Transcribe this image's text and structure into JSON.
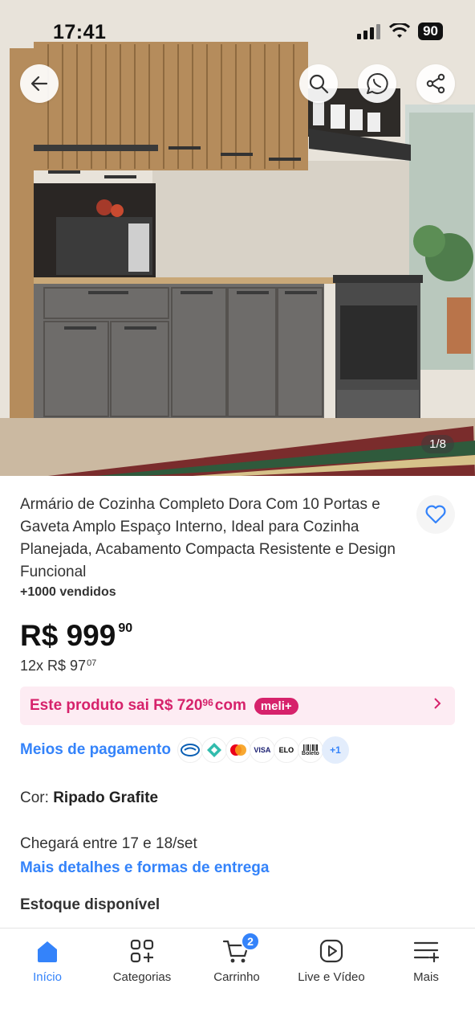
{
  "status_bar": {
    "time": "17:41",
    "battery": "90"
  },
  "gallery": {
    "counter": "1/8"
  },
  "product": {
    "title": "Armário de Cozinha Completo Dora Com 10 Portas e Gaveta Amplo Espaço Interno, Ideal para Cozinha Planejada, Acabamento Compacta Resistente e Design Funcional",
    "sold": "+1000 vendidos",
    "price_main": "R$ 999",
    "price_cents": "90",
    "installments_main": "12x R$ 97",
    "installments_cents": "07"
  },
  "meli_offer": {
    "text_main": "Este produto sai R$ 720",
    "text_cents": "96",
    "text_suffix": "com",
    "badge": "meli+"
  },
  "payment": {
    "label": "Meios de pagamento",
    "icons": [
      "mercadopago-icon",
      "pix-icon",
      "mastercard-icon",
      "visa-icon",
      "elo-icon",
      "boleto-icon"
    ],
    "visa_text": "VISA",
    "elo_text": "ELO",
    "boleto_text": "Boleto",
    "more": "+1"
  },
  "variant": {
    "label": "Cor:",
    "value": "Ripado Grafite"
  },
  "delivery": {
    "arrival": "Chegará entre 17 e 18/set",
    "more_link": "Mais detalhes e formas de entrega"
  },
  "stock": "Estoque disponível",
  "bottom_nav": {
    "items": [
      {
        "label": "Início",
        "icon": "home-icon",
        "active": true
      },
      {
        "label": "Categorias",
        "icon": "categories-icon"
      },
      {
        "label": "Carrinho",
        "icon": "cart-icon",
        "badge": "2"
      },
      {
        "label": "Live e Vídeo",
        "icon": "play-icon"
      },
      {
        "label": "Mais",
        "icon": "menu-icon"
      }
    ]
  },
  "colors": {
    "accent_blue": "#3483fa",
    "meli_pink": "#d6226b",
    "meli_bg": "#fdecf3"
  }
}
